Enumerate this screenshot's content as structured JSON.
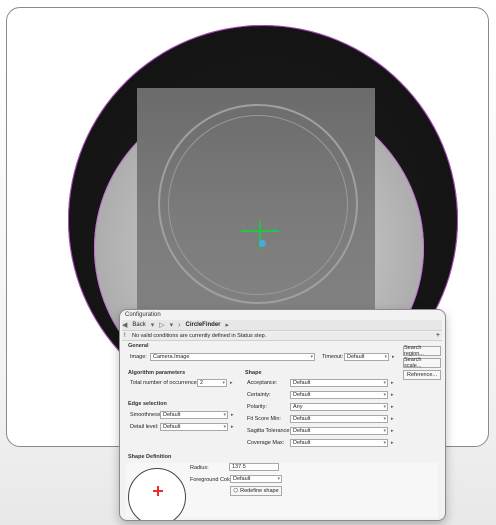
{
  "dialog": {
    "title": "Configuration",
    "nav": {
      "back": "Back",
      "step": "CircleFinder"
    },
    "banner": "No valid conditions are currently defined in Status step."
  },
  "general": {
    "section": "General",
    "image_label": "Image:",
    "image_value": "Camera.Image",
    "timeout_label": "Timeout:",
    "timeout_value": "Default"
  },
  "side_buttons": [
    "Search region...",
    "Search scale...",
    "Reference..."
  ],
  "algorithm": {
    "section": "Algorithm parameters",
    "occ_label": "Total number of occurrences:",
    "occ_value": "2"
  },
  "edge": {
    "section": "Edge selection",
    "smoothness_label": "Smoothness:",
    "smoothness_value": "Default",
    "detail_label": "Detail level:",
    "detail_value": "Default"
  },
  "shape": {
    "section": "Shape",
    "rows": [
      {
        "label": "Acceptance:",
        "value": "Default"
      },
      {
        "label": "Certainty:",
        "value": "Default"
      },
      {
        "label": "Polarity:",
        "value": "Any"
      },
      {
        "label": "Fit Score Min:",
        "value": "Default"
      },
      {
        "label": "Sagitta Tolerance:",
        "value": "Default"
      },
      {
        "label": "Coverage Max:",
        "value": "Default"
      }
    ]
  },
  "shape_definition": {
    "section": "Shape Definition",
    "radius_label": "Radius:",
    "radius_value": "137.5",
    "fg_label": "Foreground Color:",
    "fg_value": "Default",
    "redefine": "Redefine shape"
  }
}
